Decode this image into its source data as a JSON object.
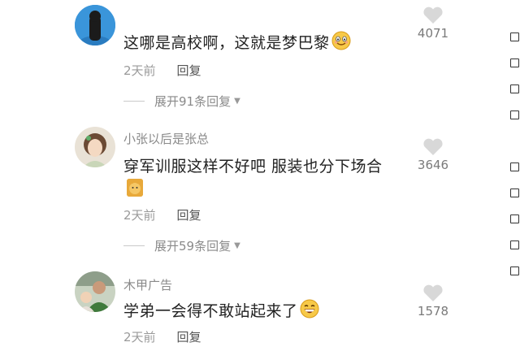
{
  "comments": [
    {
      "username": "",
      "text": "这哪是高校啊，这就是梦巴黎",
      "emoji": "smile-emoji",
      "time": "2天前",
      "reply_label": "回复",
      "likes": "4071",
      "expand_label": "展开91条回复"
    },
    {
      "username": "小张以后是张总",
      "text": "穿军训服这样不好吧 服装也分下场合",
      "sticker": "doge-sticker",
      "time": "2天前",
      "reply_label": "回复",
      "likes": "3646",
      "expand_label": "展开59条回复"
    },
    {
      "username": "木甲广告",
      "text": "学弟一会得不敢站起来了",
      "emoji": "grin-emoji",
      "time": "2天前",
      "reply_label": "回复",
      "likes": "1578"
    }
  ],
  "colors": {
    "text": "#222222",
    "secondary": "#8a8a8a",
    "like_icon": "#d8d8d8",
    "background": "#ffffff"
  }
}
